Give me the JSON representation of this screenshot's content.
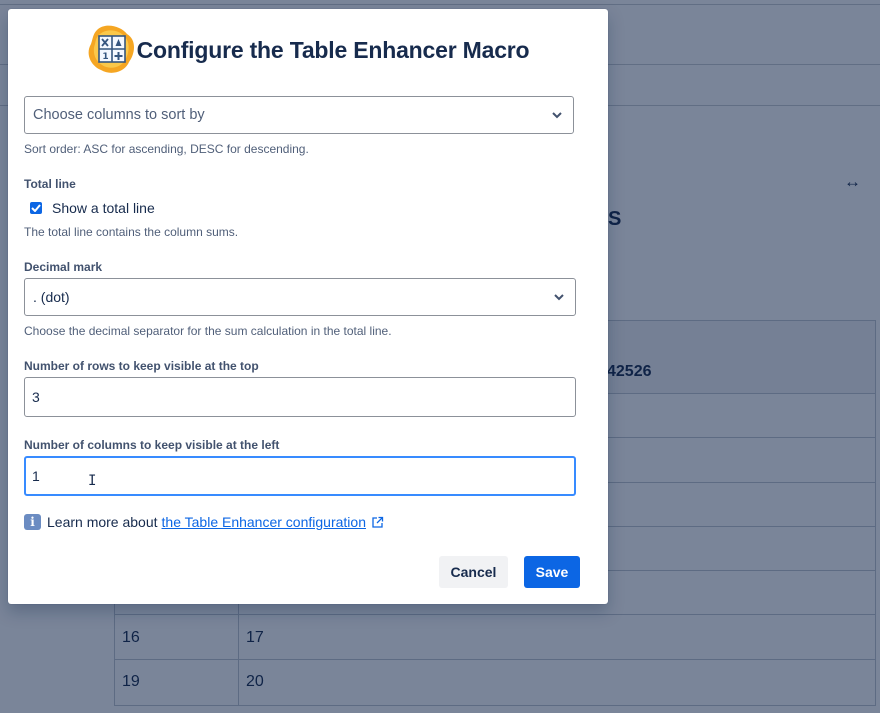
{
  "background": {
    "heading_fragment": "S",
    "header_fragment": "42526",
    "rows": [
      {
        "c1": "16",
        "c2": "17"
      },
      {
        "c1": "19",
        "c2": "20"
      }
    ]
  },
  "modal": {
    "title": "Configure the Table Enhancer Macro",
    "logo_icon": "table-calculator-icon",
    "sort": {
      "placeholder": "Choose columns to sort by",
      "help": "Sort order: ASC for ascending, DESC for descending."
    },
    "total_line": {
      "label": "Total line",
      "checkbox_label": "Show a total line",
      "checked": true,
      "help": "The total line contains the column sums."
    },
    "decimal_mark": {
      "label": "Decimal mark",
      "value": ". (dot)",
      "help": "Choose the decimal separator for the sum calculation in the total line."
    },
    "rows_top": {
      "label": "Number of rows to keep visible at the top",
      "value": "3"
    },
    "cols_left": {
      "label": "Number of columns to keep visible at the left",
      "value": "1"
    },
    "learn_more": {
      "prefix": "Learn more about",
      "link_text": "the Table Enhancer configuration"
    },
    "buttons": {
      "cancel": "Cancel",
      "save": "Save"
    }
  },
  "colors": {
    "primary": "#0c66e4",
    "focus": "#388bff",
    "text": "#172b4d"
  }
}
